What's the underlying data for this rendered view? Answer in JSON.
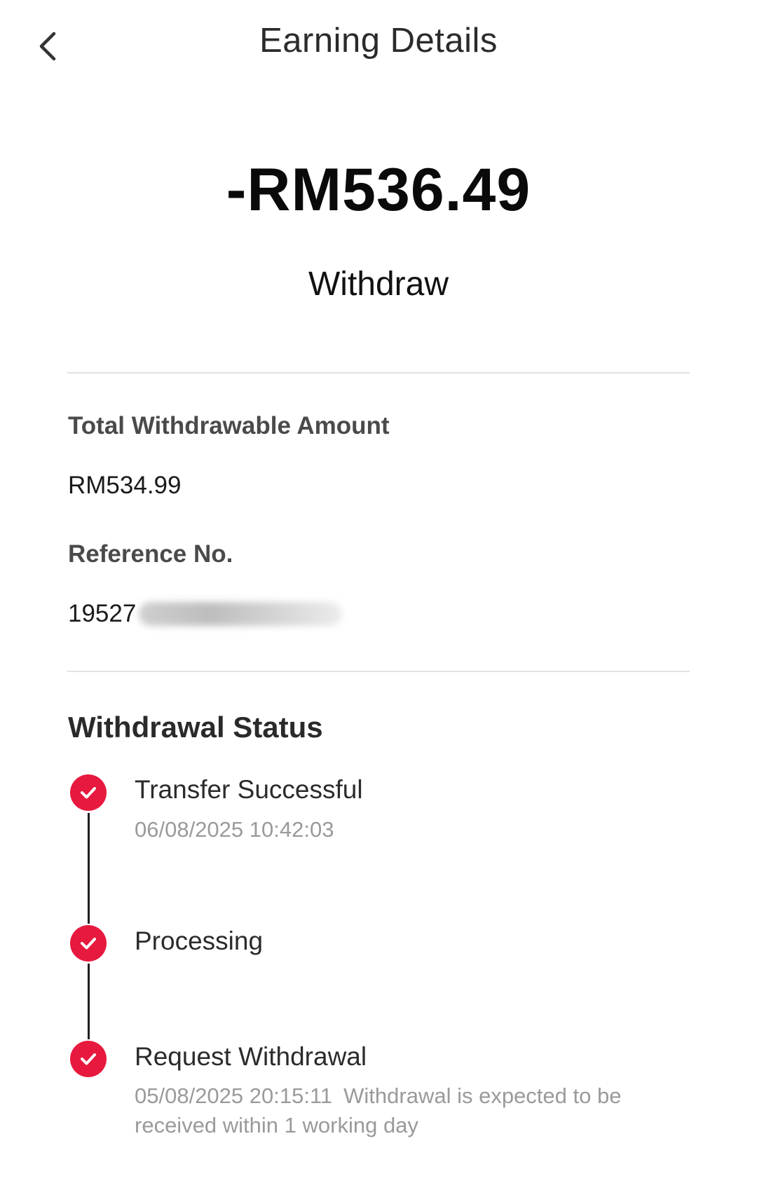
{
  "header": {
    "title": "Earning Details"
  },
  "summary": {
    "amount": "-RM536.49",
    "type": "Withdraw"
  },
  "details": {
    "total_label": "Total Withdrawable Amount",
    "total_value": "RM534.99",
    "reference_label": "Reference No.",
    "reference_value_visible": "19527"
  },
  "status": {
    "heading": "Withdrawal Status",
    "accent_color": "#e8193e",
    "steps": [
      {
        "title": "Transfer Successful",
        "datetime": "06/08/2025 10:42:03",
        "note": ""
      },
      {
        "title": "Processing",
        "datetime": "",
        "note": ""
      },
      {
        "title": "Request Withdrawal",
        "datetime": "05/08/2025 20:15:11",
        "note": "Withdrawal is expected to be received within 1 working day"
      }
    ]
  },
  "icons": {
    "back": "chevron-left-icon",
    "step_done": "check-circle-icon"
  }
}
